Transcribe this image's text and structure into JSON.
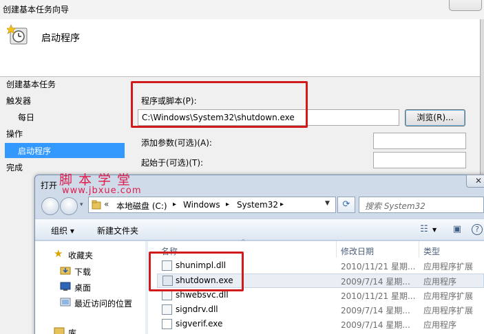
{
  "wizard": {
    "title": "创建基本任务向导",
    "header_title": "启动程序",
    "nav": {
      "create_task": "创建基本任务",
      "trigger": "触发器",
      "daily": "每日",
      "action": "操作",
      "start_program": "启动程序",
      "finish": "完成"
    },
    "program_label": "程序或脚本(P):",
    "program_value": "C:\\Windows\\System32\\shutdown.exe",
    "browse_label": "浏览(R)...",
    "args_label": "添加参数(可选)(A):",
    "startin_label": "起始于(可选)(T):"
  },
  "watermark": {
    "line1": "脚本学堂",
    "line2": "www.jbxue.com"
  },
  "open_dialog": {
    "title": "打开",
    "close_glyph": "✕",
    "address": {
      "chevrons": "«",
      "segments": [
        "本地磁盘 (C:)",
        "Windows",
        "System32"
      ],
      "sep": "▸"
    },
    "search_placeholder": "搜索 System32",
    "toolbar": {
      "organize": "组织 ▾",
      "new_folder": "新建文件夹"
    },
    "columns": {
      "name": "名称",
      "modified": "修改日期",
      "type": "类型"
    },
    "tree": {
      "favorites": "收藏夹",
      "downloads": "下载",
      "desktop": "桌面",
      "recent": "最近访问的位置",
      "library": "库"
    },
    "files": [
      {
        "name": "shunimpl.dll",
        "date": "2010/11/21 星期...",
        "type": "应用程序扩展"
      },
      {
        "name": "shutdown.exe",
        "date": "2009/7/14 星期...",
        "type": "应用程序"
      },
      {
        "name": "shwebsvc.dll",
        "date": "2010/11/21 星期...",
        "type": "应用程序扩展"
      },
      {
        "name": "signdrv.dll",
        "date": "2009/7/14 星期...",
        "type": "应用程序扩展"
      },
      {
        "name": "sigverif.exe",
        "date": "2009/7/14 星期...",
        "type": "应用程序"
      }
    ]
  },
  "colors": {
    "highlight": "#d11b1b",
    "selection": "#3399ff",
    "watermark": "#e01b4b"
  },
  "icons": {
    "wizard_header": "task-clock-icon",
    "favorites": "star-icon",
    "downloads": "download-folder-icon",
    "desktop": "desktop-icon",
    "recent": "recent-places-icon",
    "dll": "dll-file-icon",
    "exe": "exe-file-icon"
  }
}
